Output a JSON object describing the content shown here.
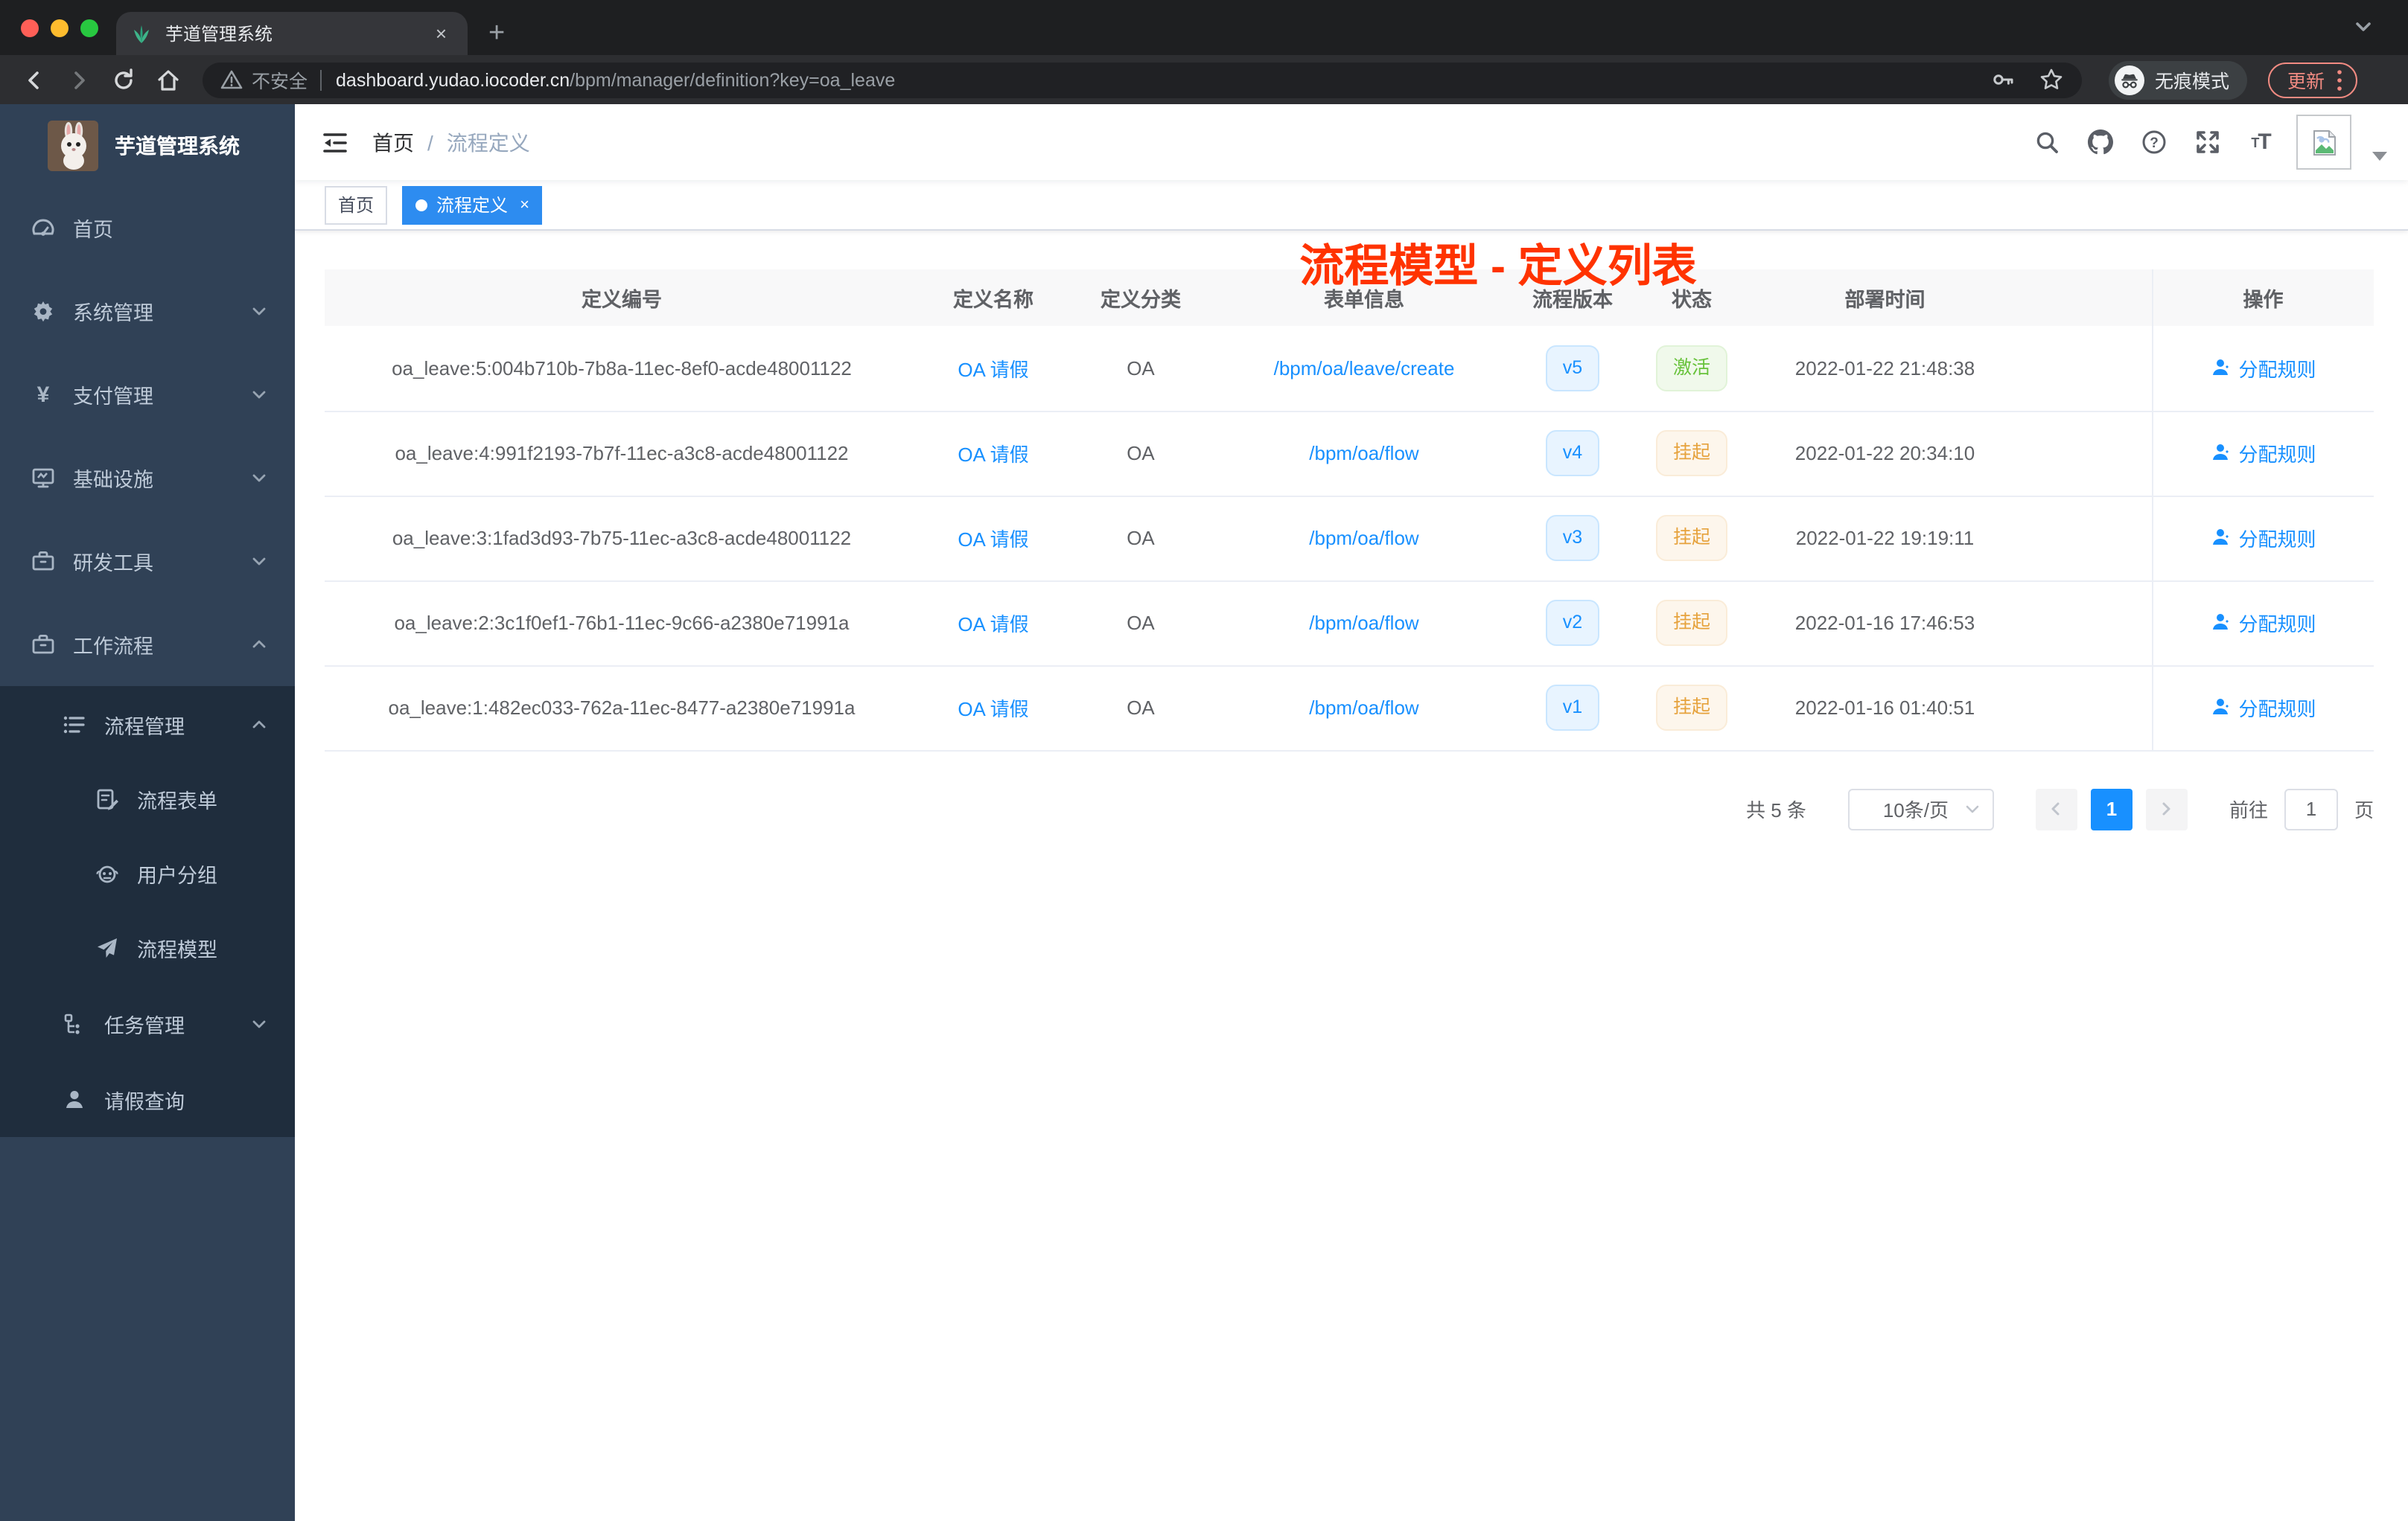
{
  "colors": {
    "primary": "#1890ff",
    "success": "#67c23a",
    "warning": "#e6a23c",
    "red": "#ff3300",
    "sidebar-bg": "#304156",
    "submenu-bg": "#1f2d3d",
    "tag-active": "#2d8cf0"
  },
  "browser": {
    "tab_title": "芋道管理系统",
    "close_tab": "×",
    "new_tab": "+",
    "security_label": "不安全",
    "url_domain": "dashboard.yudao.iocoder.cn",
    "url_path": "/bpm/manager/definition?key=oa_leave",
    "incognito_label": "无痕模式",
    "update_label": "更新"
  },
  "sidebar": {
    "app_title": "芋道管理系统",
    "items": [
      {
        "label": "首页",
        "icon": "gauge-icon",
        "level": 1,
        "chevron": "",
        "dark": false
      },
      {
        "label": "系统管理",
        "icon": "gear-icon",
        "level": 1,
        "chevron": "down",
        "dark": false
      },
      {
        "label": "支付管理",
        "icon": "yen-icon",
        "level": 1,
        "chevron": "down",
        "dark": false
      },
      {
        "label": "基础设施",
        "icon": "monitor-icon",
        "level": 1,
        "chevron": "down",
        "dark": false
      },
      {
        "label": "研发工具",
        "icon": "toolbox-icon",
        "level": 1,
        "chevron": "down",
        "dark": false
      },
      {
        "label": "工作流程",
        "icon": "briefcase-icon",
        "level": 1,
        "chevron": "up",
        "dark": false
      },
      {
        "label": "流程管理",
        "icon": "list-tree-icon",
        "level": 2,
        "chevron": "up",
        "dark": true
      },
      {
        "label": "流程表单",
        "icon": "form-edit-icon",
        "level": 3,
        "chevron": "",
        "dark": true
      },
      {
        "label": "用户分组",
        "icon": "robot-icon",
        "level": 3,
        "chevron": "",
        "dark": true
      },
      {
        "label": "流程模型",
        "icon": "paper-plane-icon",
        "level": 3,
        "chevron": "",
        "dark": true
      },
      {
        "label": "任务管理",
        "icon": "flow-icon",
        "level": 2,
        "chevron": "down",
        "dark": true
      },
      {
        "label": "请假查询",
        "icon": "person-icon",
        "level": 2,
        "chevron": "",
        "dark": true
      }
    ]
  },
  "navbar": {
    "breadcrumb": {
      "home": "首页",
      "separator": "/",
      "current": "流程定义"
    },
    "overlay_title": "流程模型 - 定义列表"
  },
  "tags": [
    {
      "label": "首页",
      "active": false
    },
    {
      "label": "流程定义",
      "active": true,
      "close": "×"
    }
  ],
  "table": {
    "headers": [
      "定义编号",
      "定义名称",
      "定义分类",
      "表单信息",
      "流程版本",
      "状态",
      "部署时间",
      "操作"
    ],
    "rows": [
      {
        "id": "oa_leave:5:004b710b-7b8a-11ec-8ef0-acde48001122",
        "name": "OA 请假",
        "category": "OA",
        "form": "/bpm/oa/leave/create",
        "version": "v5",
        "status": "激活",
        "status_type": "success",
        "time": "2022-01-22 21:48:38",
        "action": "分配规则"
      },
      {
        "id": "oa_leave:4:991f2193-7b7f-11ec-a3c8-acde48001122",
        "name": "OA 请假",
        "category": "OA",
        "form": "/bpm/oa/flow",
        "version": "v4",
        "status": "挂起",
        "status_type": "warning",
        "time": "2022-01-22 20:34:10",
        "action": "分配规则"
      },
      {
        "id": "oa_leave:3:1fad3d93-7b75-11ec-a3c8-acde48001122",
        "name": "OA 请假",
        "category": "OA",
        "form": "/bpm/oa/flow",
        "version": "v3",
        "status": "挂起",
        "status_type": "warning",
        "time": "2022-01-22 19:19:11",
        "action": "分配规则"
      },
      {
        "id": "oa_leave:2:3c1f0ef1-76b1-11ec-9c66-a2380e71991a",
        "name": "OA 请假",
        "category": "OA",
        "form": "/bpm/oa/flow",
        "version": "v2",
        "status": "挂起",
        "status_type": "warning",
        "time": "2022-01-16 17:46:53",
        "action": "分配规则"
      },
      {
        "id": "oa_leave:1:482ec033-762a-11ec-8477-a2380e71991a",
        "name": "OA 请假",
        "category": "OA",
        "form": "/bpm/oa/flow",
        "version": "v1",
        "status": "挂起",
        "status_type": "warning",
        "time": "2022-01-16 01:40:51",
        "action": "分配规则"
      }
    ]
  },
  "pagination": {
    "total_label": "共 5 条",
    "page_size": "10条/页",
    "current_page": "1",
    "goto_label": "前往",
    "goto_value": "1",
    "page_unit": "页"
  }
}
